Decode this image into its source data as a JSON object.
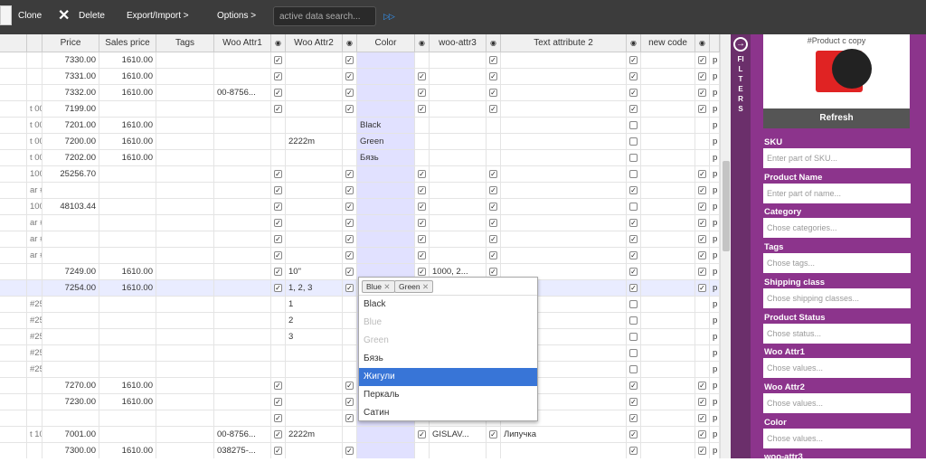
{
  "toolbar": {
    "clone": "Clone",
    "delete": "Delete",
    "export": "Export/Import >",
    "options": "Options >",
    "search_placeholder": "active data search...",
    "arrows": "▷▷"
  },
  "columns": [
    "",
    "",
    "Price",
    "Sales price",
    "Tags",
    "Woo Attr1",
    "◉",
    "Woo Attr2",
    "◉",
    "Color",
    "◉",
    "woo-attr3",
    "◉",
    "Text attribute 2",
    "◉",
    "new code",
    "◉",
    ""
  ],
  "rows": [
    {
      "a": "",
      "price": "7330.00",
      "sales": "1610.00",
      "w1": "",
      "w2": "",
      "color": "",
      "w3": "",
      "t2": "",
      "e1": 1,
      "e2": 1,
      "e3": 0,
      "e4": 1,
      "e5": 1,
      "e6": 1,
      "p": "p"
    },
    {
      "a": "",
      "price": "7331.00",
      "sales": "1610.00",
      "w1": "",
      "w2": "",
      "color": "",
      "w3": "",
      "t2": "",
      "e1": 1,
      "e2": 1,
      "e3": 1,
      "e4": 1,
      "e5": 1,
      "e6": 1,
      "p": "p"
    },
    {
      "a": "",
      "price": "7332.00",
      "sales": "1610.00",
      "w1": "00-8756...",
      "w2": "",
      "color": "",
      "w3": "",
      "t2": "",
      "e1": 1,
      "e2": 1,
      "e3": 1,
      "e4": 1,
      "e5": 1,
      "e6": 1,
      "p": "p"
    },
    {
      "a": "t 008",
      "price": "7199.00",
      "sales": "",
      "w1": "",
      "w2": "",
      "color": "",
      "w3": "",
      "t2": "",
      "e1": 1,
      "e2": 1,
      "e3": 1,
      "e4": 1,
      "e5": 1,
      "e6": 1,
      "p": "p"
    },
    {
      "a": "t 008...",
      "price": "7201.00",
      "sales": "1610.00",
      "w1": "",
      "w2": "",
      "color": "Black",
      "w3": "",
      "t2": "",
      "e1": 0,
      "e2": 0,
      "e3": 0,
      "e4": 0,
      "e5": 0,
      "e6": 0,
      "p": "p"
    },
    {
      "a": "t 008...",
      "price": "7200.00",
      "sales": "1610.00",
      "w1": "",
      "w2": "2222m",
      "color": "Green",
      "w3": "",
      "t2": "",
      "e1": 0,
      "e2": 0,
      "e3": 0,
      "e4": 0,
      "e5": 0,
      "e6": 0,
      "p": "p"
    },
    {
      "a": "t 008...",
      "price": "7202.00",
      "sales": "1610.00",
      "w1": "",
      "w2": "",
      "color": "Бязь",
      "w3": "",
      "t2": "",
      "e1": 0,
      "e2": 0,
      "e3": 0,
      "e4": 0,
      "e5": 0,
      "e6": 0,
      "p": "p"
    },
    {
      "a": "100...",
      "price": "25256.70",
      "sales": "",
      "w1": "",
      "w2": "",
      "color": "",
      "w3": "",
      "t2": "",
      "e1": 1,
      "e2": 1,
      "e3": 1,
      "e4": 1,
      "e5": 0,
      "e6": 1,
      "p": "p"
    },
    {
      "a": "ar #...",
      "price": "",
      "sales": "",
      "w1": "",
      "w2": "",
      "color": "",
      "w3": "",
      "t2": "",
      "e1": 1,
      "e2": 1,
      "e3": 1,
      "e4": 1,
      "e5": 1,
      "e6": 1,
      "p": "p"
    },
    {
      "a": "1000...",
      "price": "48103.44",
      "sales": "",
      "w1": "",
      "w2": "",
      "color": "",
      "w3": "",
      "t2": "",
      "e1": 1,
      "e2": 1,
      "e3": 1,
      "e4": 1,
      "e5": 0,
      "e6": 1,
      "p": "p"
    },
    {
      "a": "ar #...",
      "price": "",
      "sales": "",
      "w1": "",
      "w2": "",
      "color": "",
      "w3": "",
      "t2": "",
      "e1": 1,
      "e2": 1,
      "e3": 1,
      "e4": 1,
      "e5": 1,
      "e6": 1,
      "p": "p"
    },
    {
      "a": "ar #...",
      "price": "",
      "sales": "",
      "w1": "",
      "w2": "",
      "color": "",
      "w3": "",
      "t2": "",
      "e1": 1,
      "e2": 1,
      "e3": 1,
      "e4": 1,
      "e5": 1,
      "e6": 1,
      "p": "p"
    },
    {
      "a": "ar #...",
      "price": "",
      "sales": "",
      "w1": "",
      "w2": "",
      "color": "",
      "w3": "",
      "t2": "",
      "e1": 1,
      "e2": 1,
      "e3": 1,
      "e4": 1,
      "e5": 1,
      "e6": 1,
      "p": "p"
    },
    {
      "a": "",
      "price": "7249.00",
      "sales": "1610.00",
      "w1": "",
      "w2": "10\"",
      "color": "",
      "w3": "1000, 2...",
      "t2": "",
      "e1": 1,
      "e2": 1,
      "e3": 1,
      "e4": 1,
      "e5": 1,
      "e6": 1,
      "p": "p"
    },
    {
      "a": "",
      "price": "7254.00",
      "sales": "1610.00",
      "w1": "",
      "w2": "1, 2, 3",
      "color": "",
      "w3": "",
      "t2": "",
      "e1": 1,
      "e2": 1,
      "e3": 0,
      "e4": 0,
      "e5": 1,
      "e6": 1,
      "p": "p",
      "sel": 1
    },
    {
      "a": "#259...",
      "price": "",
      "sales": "",
      "w1": "",
      "w2": "1",
      "color": "",
      "w3": "",
      "t2": "",
      "e1": 0,
      "e2": 0,
      "e3": 0,
      "e4": 0,
      "e5": 0,
      "e6": 0,
      "p": "p"
    },
    {
      "a": "#259...",
      "price": "",
      "sales": "",
      "w1": "",
      "w2": "2",
      "color": "",
      "w3": "",
      "t2": "",
      "e1": 0,
      "e2": 0,
      "e3": 0,
      "e4": 0,
      "e5": 0,
      "e6": 0,
      "p": "p"
    },
    {
      "a": "#259...",
      "price": "",
      "sales": "",
      "w1": "",
      "w2": "3",
      "color": "",
      "w3": "",
      "t2": "",
      "e1": 0,
      "e2": 0,
      "e3": 0,
      "e4": 0,
      "e5": 0,
      "e6": 0,
      "p": "p"
    },
    {
      "a": "#259...",
      "price": "",
      "sales": "",
      "w1": "",
      "w2": "",
      "color": "",
      "w3": "",
      "t2": "",
      "e1": 0,
      "e2": 0,
      "e3": 0,
      "e4": 0,
      "e5": 0,
      "e6": 0,
      "p": "p"
    },
    {
      "a": "#259...",
      "price": "",
      "sales": "",
      "w1": "",
      "w2": "",
      "color": "",
      "w3": "",
      "t2": "",
      "e1": 0,
      "e2": 0,
      "e3": 0,
      "e4": 0,
      "e5": 0,
      "e6": 0,
      "p": "p"
    },
    {
      "a": "",
      "price": "7270.00",
      "sales": "1610.00",
      "w1": "",
      "w2": "",
      "color": "",
      "w3": "",
      "t2": "",
      "e1": 1,
      "e2": 1,
      "e3": 0,
      "e4": 0,
      "e5": 1,
      "e6": 1,
      "p": "p"
    },
    {
      "a": "",
      "price": "7230.00",
      "sales": "1610.00",
      "w1": "",
      "w2": "",
      "color": "",
      "w3": "",
      "t2": "",
      "e1": 1,
      "e2": 1,
      "e3": 0,
      "e4": 0,
      "e5": 1,
      "e6": 1,
      "p": "p"
    },
    {
      "a": "",
      "price": "",
      "sales": "",
      "w1": "",
      "w2": "",
      "color": "",
      "w3": "",
      "t2": "",
      "e1": 1,
      "e2": 1,
      "e3": 0,
      "e4": 0,
      "e5": 1,
      "e6": 1,
      "p": "p"
    },
    {
      "a": "t 10...",
      "price": "7001.00",
      "sales": "",
      "w1": "00-8756...",
      "w2": "2222m",
      "color": "",
      "w3": "GISLAV...",
      "t2": "Липучка",
      "e1": 1,
      "e2": 0,
      "e3": 1,
      "e4": 1,
      "e5": 1,
      "e6": 1,
      "p": "p"
    },
    {
      "a": "",
      "price": "7300.00",
      "sales": "1610.00",
      "w1": "038275-...",
      "w2": "",
      "color": "",
      "w3": "",
      "t2": "",
      "e1": 1,
      "e2": 1,
      "e3": 0,
      "e4": 0,
      "e5": 1,
      "e6": 1,
      "p": "p"
    }
  ],
  "popup": {
    "tags": [
      "Blue",
      "Green"
    ],
    "options": [
      {
        "label": "Black",
        "state": "normal"
      },
      {
        "label": "Blue",
        "state": "disabled"
      },
      {
        "label": "Green",
        "state": "disabled"
      },
      {
        "label": "Бязь",
        "state": "normal"
      },
      {
        "label": "Жигули",
        "state": "highlighted"
      },
      {
        "label": "Перкаль",
        "state": "normal"
      },
      {
        "label": "Сатин",
        "state": "normal"
      }
    ]
  },
  "filters_tab": {
    "label": "FILTERS",
    "icon": "arrow-right-circle-icon"
  },
  "panel": {
    "product_title": "#Product c copy",
    "refresh": "Refresh",
    "fields": [
      {
        "label": "SKU",
        "placeholder": "Enter part of SKU..."
      },
      {
        "label": "Product Name",
        "placeholder": "Enter part of name..."
      },
      {
        "label": "Category",
        "placeholder": "Chose categories..."
      },
      {
        "label": "Tags",
        "placeholder": "Chose tags..."
      },
      {
        "label": "Shipping class",
        "placeholder": "Chose shipping classes..."
      },
      {
        "label": "Product Status",
        "placeholder": "Chose status..."
      },
      {
        "label": "Woo Attr1",
        "placeholder": "Chose values..."
      },
      {
        "label": "Woo Attr2",
        "placeholder": "Chose values..."
      },
      {
        "label": "Color",
        "placeholder": "Chose values..."
      },
      {
        "label": "woo-attr3",
        "placeholder": ""
      }
    ]
  },
  "colors": {
    "toolbar": "#3c3c3c",
    "panel": "#8c348c",
    "tab": "#6b2f6b",
    "highlight": "#3875d7",
    "color_column": "#e1e1ff"
  }
}
